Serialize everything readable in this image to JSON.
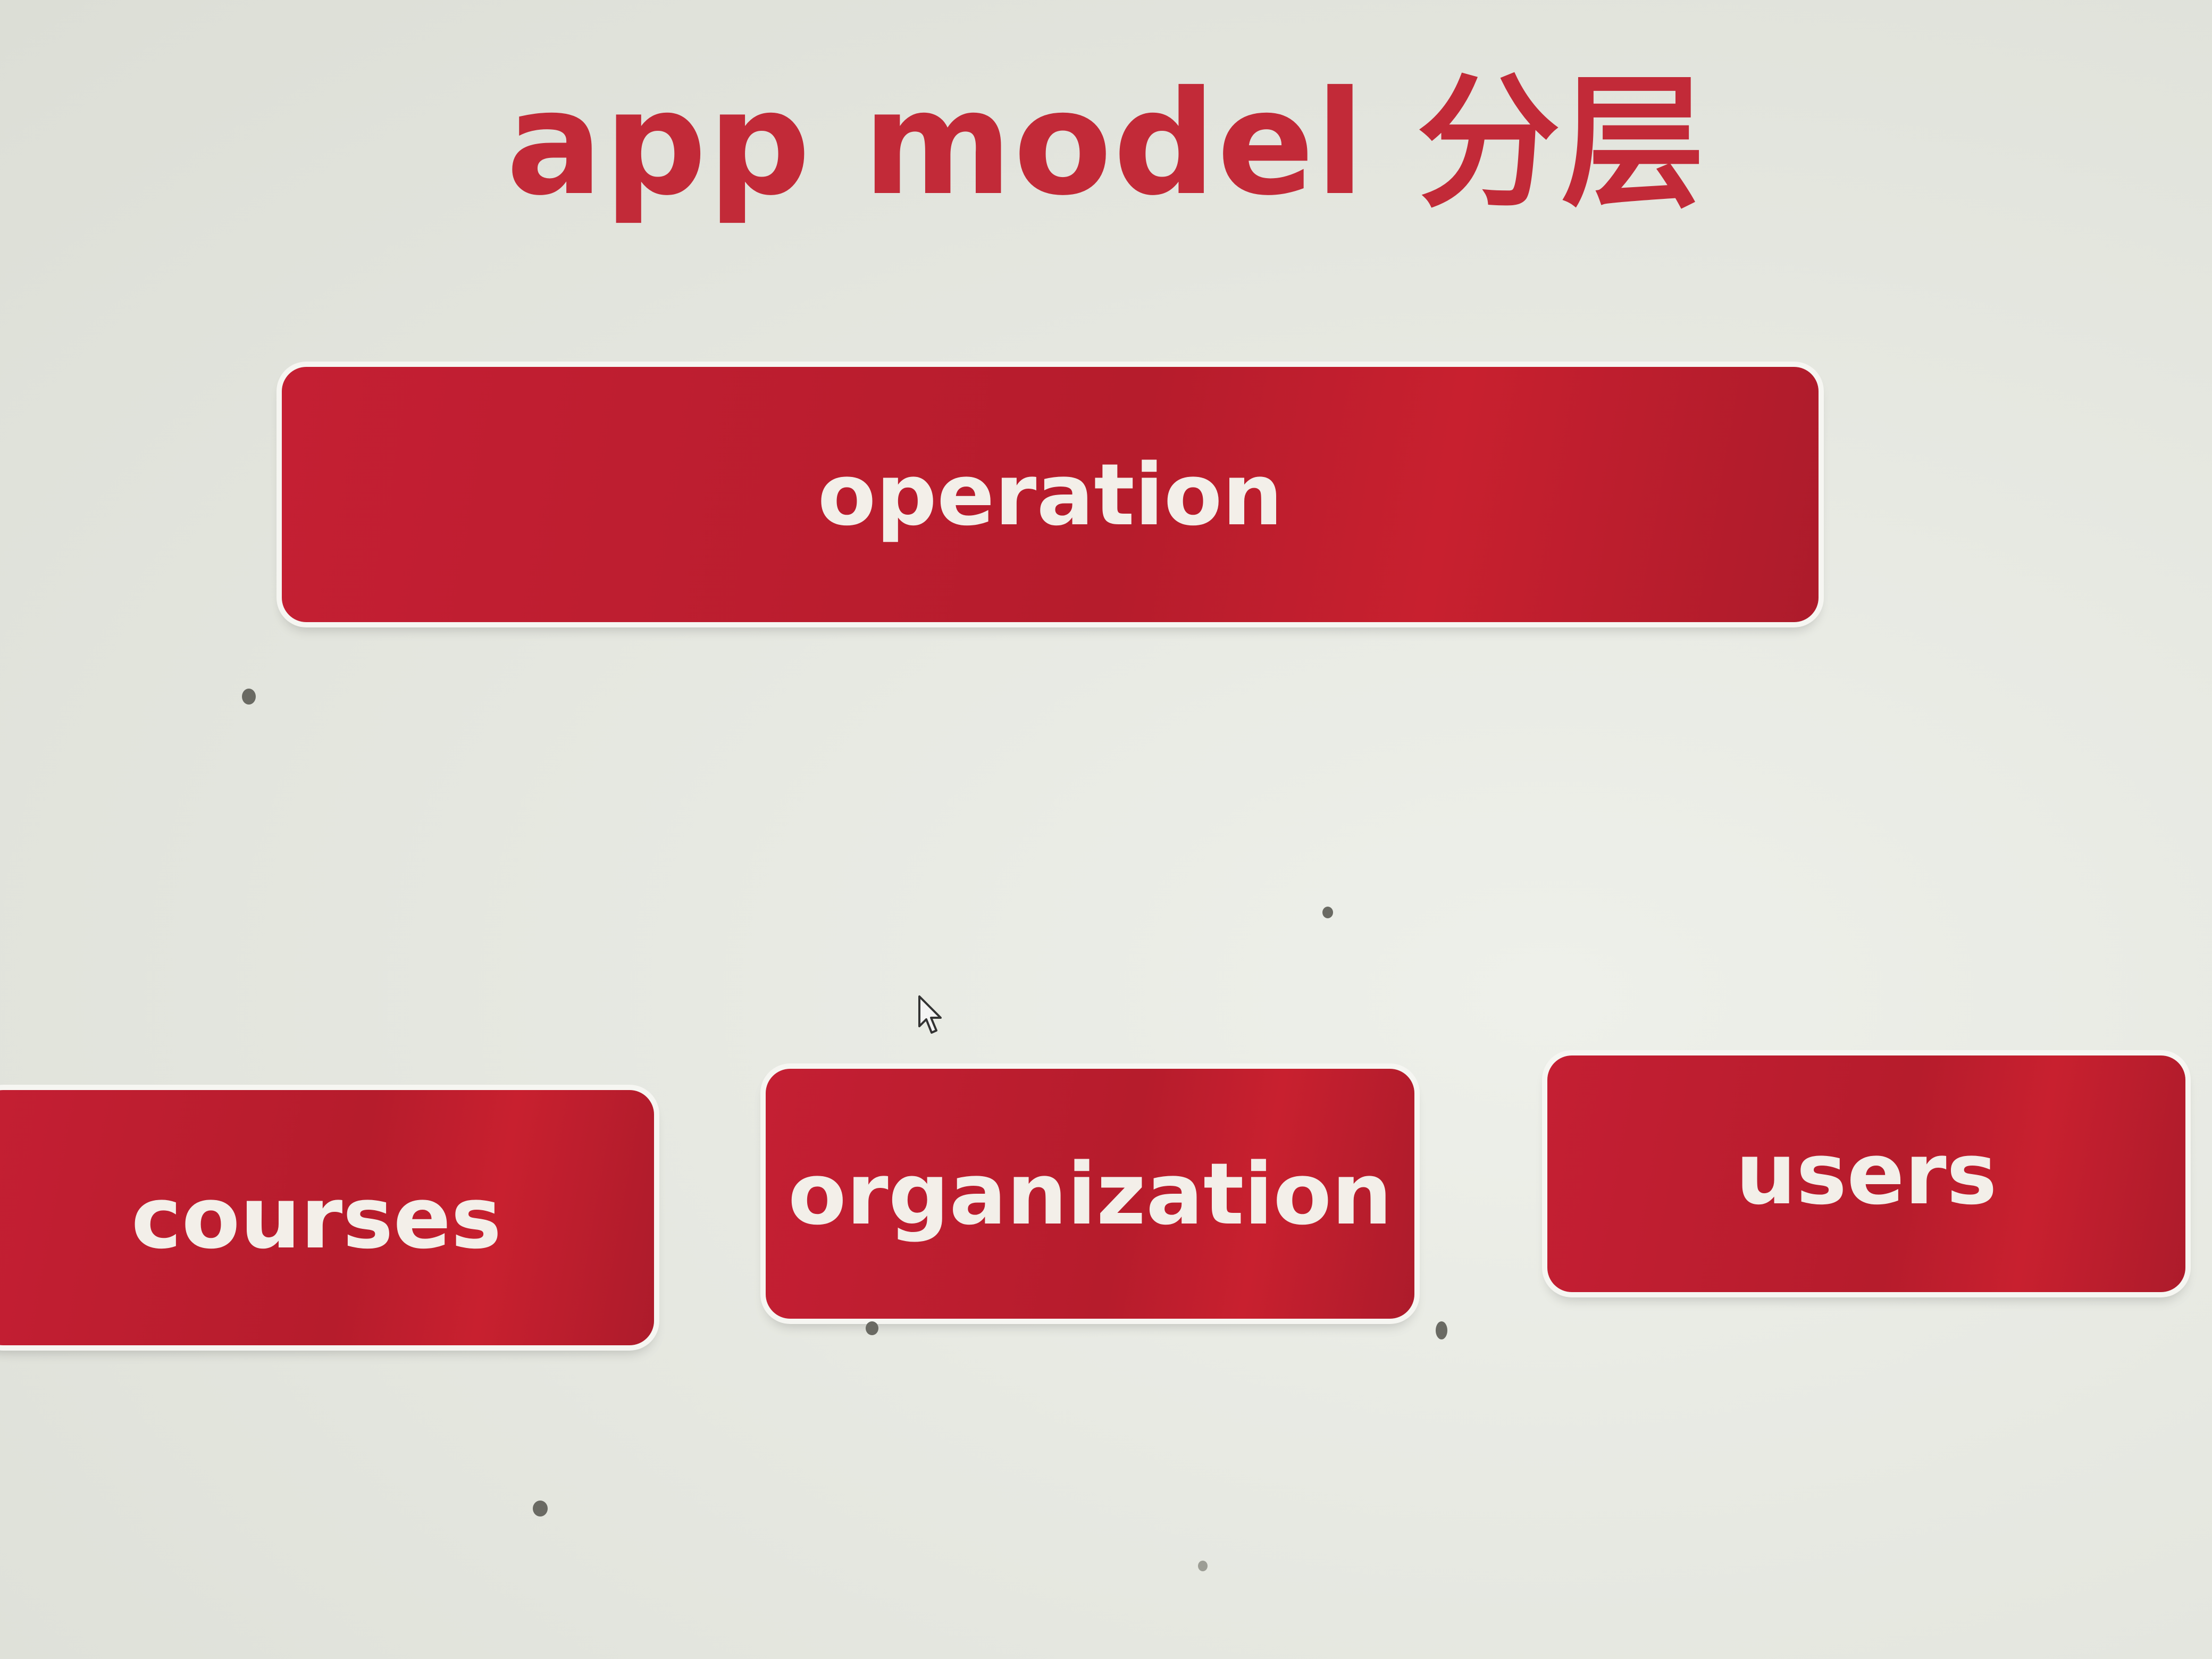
{
  "title": "app model 分层",
  "nodes": {
    "operation": "operation",
    "courses": "courses",
    "organization": "organization",
    "users": "users"
  },
  "colors": {
    "accent": "#c22a38",
    "box_fill": "#b81d2e",
    "box_text": "#f3efe9",
    "background": "#e6e8e1"
  }
}
